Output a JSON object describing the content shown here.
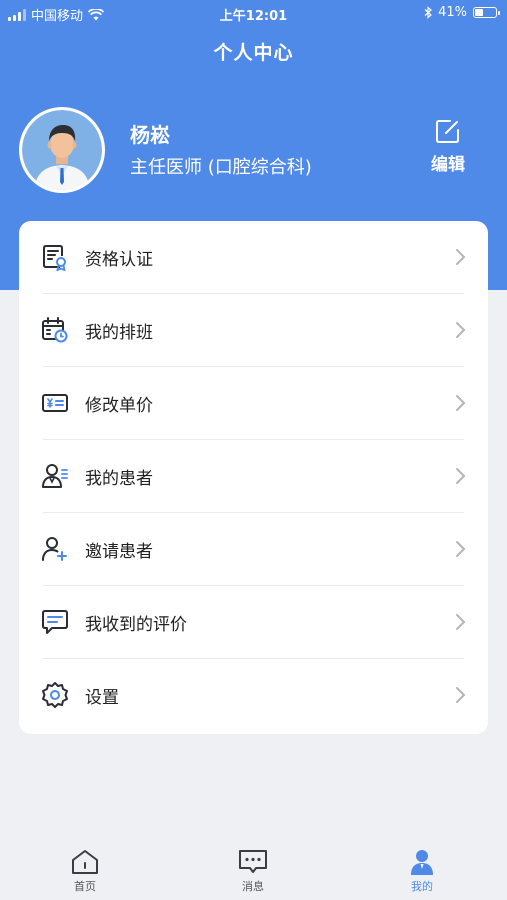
{
  "status_bar": {
    "carrier": "中国移动",
    "time": "上午12:01",
    "battery": "41%",
    "battery_level": 0.41
  },
  "header": {
    "title": "个人中心"
  },
  "profile": {
    "name": "杨崧",
    "title": "主任医师 (口腔综合科)",
    "edit_label": "编辑"
  },
  "menu": {
    "items": [
      {
        "label": "资格认证",
        "icon": "certificate-icon"
      },
      {
        "label": "我的排班",
        "icon": "calendar-schedule-icon"
      },
      {
        "label": "修改单价",
        "icon": "price-card-icon"
      },
      {
        "label": "我的患者",
        "icon": "patients-icon"
      },
      {
        "label": "邀请患者",
        "icon": "invite-user-icon"
      },
      {
        "label": "我收到的评价",
        "icon": "comment-icon"
      },
      {
        "label": "设置",
        "icon": "settings-gear-icon"
      }
    ]
  },
  "tabbar": {
    "tabs": [
      {
        "label": "首页",
        "icon": "home-icon",
        "active": false
      },
      {
        "label": "消息",
        "icon": "message-icon",
        "active": false
      },
      {
        "label": "我的",
        "icon": "person-icon",
        "active": true
      }
    ]
  },
  "colors": {
    "primary": "#4f8ae8",
    "background": "#eef0f4",
    "card": "#ffffff"
  }
}
